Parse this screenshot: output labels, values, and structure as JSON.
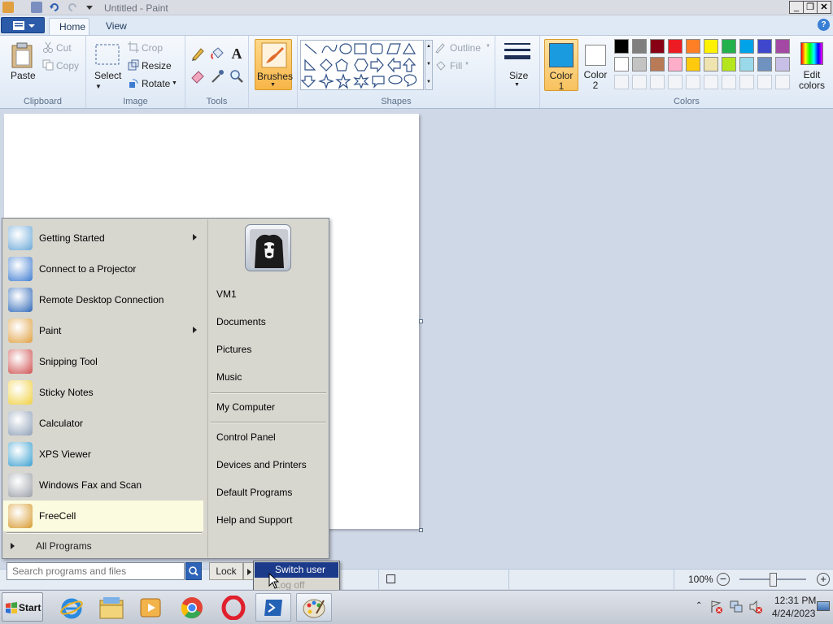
{
  "window": {
    "title": "Untitled - Paint"
  },
  "tabs": {
    "home": "Home",
    "view": "View"
  },
  "help_icon": "?",
  "ribbon": {
    "clipboard": {
      "label": "Clipboard",
      "paste": "Paste",
      "cut": "Cut",
      "copy": "Copy"
    },
    "image": {
      "label": "Image",
      "select": "Select",
      "crop": "Crop",
      "resize": "Resize",
      "rotate": "Rotate"
    },
    "tools": {
      "label": "Tools"
    },
    "brushes": {
      "label": "Brushes"
    },
    "shapes": {
      "label": "Shapes",
      "outline": "Outline",
      "fill": "Fill"
    },
    "size": {
      "label": "Size"
    },
    "colors": {
      "label": "Colors",
      "color1": "Color 1",
      "color2": "Color 2",
      "edit": "Edit colors",
      "color1_value": "#1a9be0",
      "color2_value": "#ffffff",
      "palette_row1": [
        "#000000",
        "#7f7f7f",
        "#880015",
        "#ed1c24",
        "#ff7f27",
        "#fff200",
        "#22b14c",
        "#00a2e8",
        "#3f48cc",
        "#a349a4"
      ],
      "palette_row2": [
        "#ffffff",
        "#c3c3c3",
        "#b97a57",
        "#ffaec9",
        "#ffc90e",
        "#efe4b0",
        "#b5e61d",
        "#99d9ea",
        "#7092be",
        "#c8bfe7"
      ]
    }
  },
  "status": {
    "zoom": "100%"
  },
  "start_menu": {
    "programs": [
      {
        "label": "Getting Started",
        "submenu": true
      },
      {
        "label": "Connect to a Projector",
        "submenu": false
      },
      {
        "label": "Remote Desktop Connection",
        "submenu": false
      },
      {
        "label": "Paint",
        "submenu": true
      },
      {
        "label": "Snipping Tool",
        "submenu": false
      },
      {
        "label": "Sticky Notes",
        "submenu": false
      },
      {
        "label": "Calculator",
        "submenu": false
      },
      {
        "label": "XPS Viewer",
        "submenu": false
      },
      {
        "label": "Windows Fax and Scan",
        "submenu": false
      },
      {
        "label": "FreeCell",
        "submenu": false
      }
    ],
    "all_programs": "All Programs",
    "search_placeholder": "Search programs and files",
    "right_links": {
      "user": "VM1",
      "documents": "Documents",
      "pictures": "Pictures",
      "music": "Music",
      "computer": "My Computer",
      "control_panel": "Control Panel",
      "devices": "Devices and Printers",
      "default_programs": "Default Programs",
      "help": "Help and Support"
    },
    "lock": "Lock",
    "power_submenu": {
      "switch_user": "Switch user",
      "log_off": "Log off"
    }
  },
  "taskbar": {
    "start": "Start",
    "time": "12:31 PM",
    "date": "4/24/2023"
  }
}
